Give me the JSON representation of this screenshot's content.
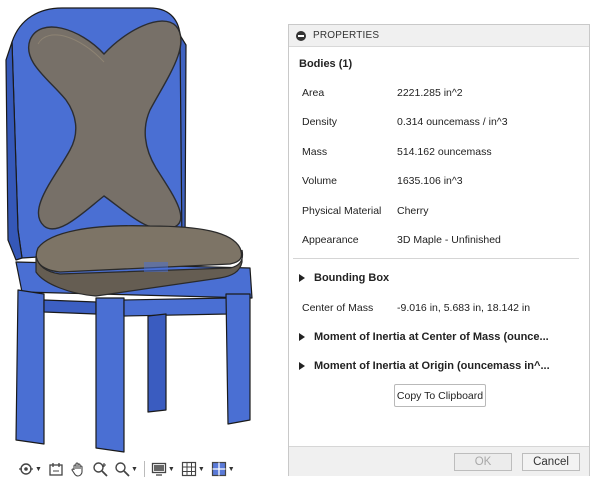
{
  "panel": {
    "title": "PROPERTIES",
    "bodies_title": "Bodies (1)",
    "properties": [
      {
        "label": "Area",
        "value": "2221.285 in^2"
      },
      {
        "label": "Density",
        "value": "0.314 ouncemass / in^3"
      },
      {
        "label": "Mass",
        "value": "514.162 ouncemass"
      },
      {
        "label": "Volume",
        "value": "1635.106 in^3"
      },
      {
        "label": "Physical Material",
        "value": "Cherry"
      },
      {
        "label": "Appearance",
        "value": "3D Maple - Unfinished"
      }
    ],
    "bounding_box": "Bounding Box",
    "center_of_mass": {
      "label": "Center of Mass",
      "value": "-9.016 in, 5.683 in, 18.142 in"
    },
    "moment_center": "Moment of Inertia at Center of Mass   (ounce...",
    "moment_origin": "Moment of Inertia at Origin   (ouncemass in^...",
    "copy_button": "Copy To Clipboard",
    "ok_button": "OK",
    "cancel_button": "Cancel"
  },
  "navbar": {
    "icons": [
      "orbit-icon",
      "look-at-icon",
      "pan-icon",
      "zoom-window-icon",
      "zoom-icon",
      "display-settings-icon",
      "grid-icon",
      "viewports-icon"
    ]
  },
  "colors": {
    "chair_blue": "#4a6fd3",
    "cushion_gray": "#756c60"
  }
}
